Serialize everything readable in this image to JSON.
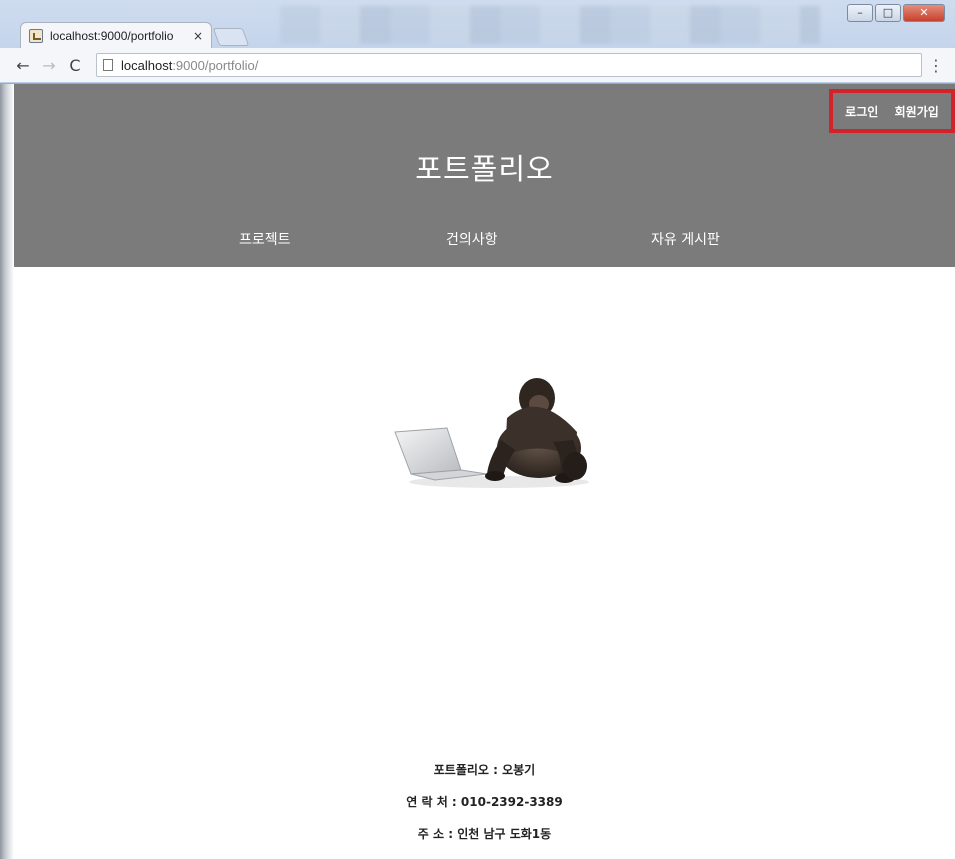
{
  "browser": {
    "tab_title": "localhost:9000/portfolio",
    "tab_close": "×",
    "url_host": "localhost",
    "url_rest": ":9000/portfolio/",
    "back_icon": "←",
    "forward_icon": "→",
    "reload_icon": "C",
    "menu_icon": "⋮",
    "window_controls": {
      "minimize": "–",
      "maximize": "□",
      "close": "✕"
    }
  },
  "header": {
    "login_label": "로그인",
    "signup_label": "회원가입",
    "site_title": "포트폴리오",
    "nav": [
      "프로젝트",
      "건의사항",
      "자유 게시판"
    ]
  },
  "hero": {
    "description": "gorilla-with-laptop"
  },
  "footer": {
    "line1": "포트폴리오 : 오봉기",
    "line2": "연 락 처 : 010-2392-3389",
    "line3": "주 소 : 인천 남구 도화1동"
  },
  "colors": {
    "header_bg": "#7b7b7b",
    "highlight_box": "#d2232a"
  }
}
